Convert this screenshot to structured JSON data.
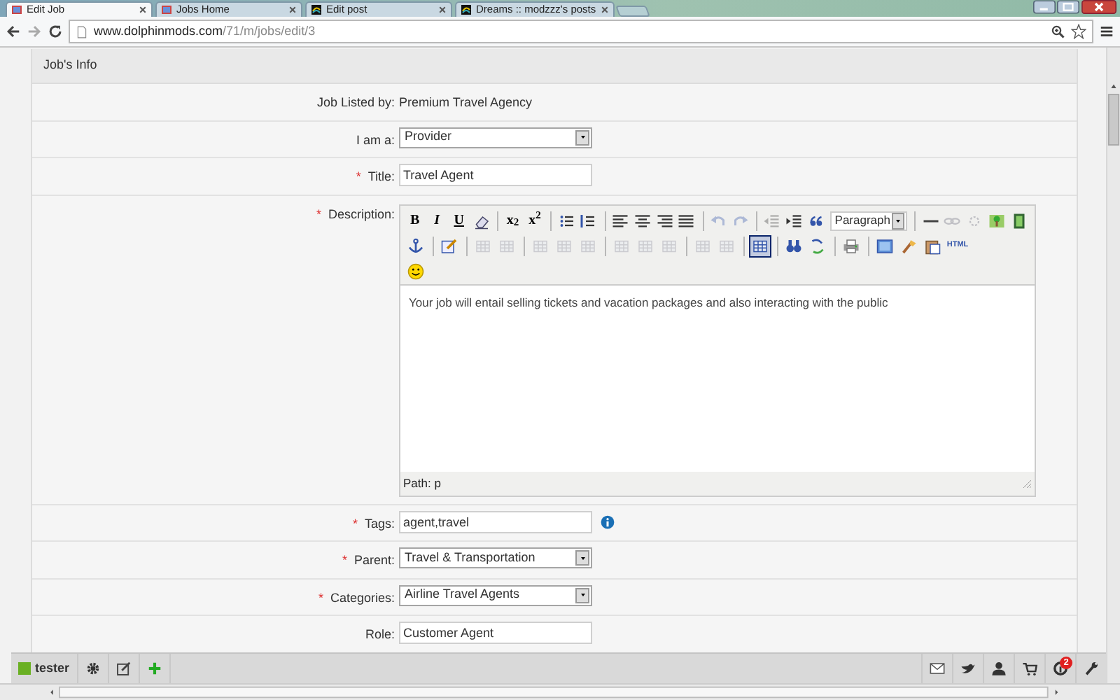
{
  "browser": {
    "tabs": [
      {
        "title": "Edit Job",
        "selected": true
      },
      {
        "title": "Jobs Home",
        "selected": false
      },
      {
        "title": "Edit post",
        "selected": false
      },
      {
        "title": "Dreams :: modzzz's posts",
        "selected": false
      }
    ],
    "address": {
      "host": "www.dolphinmods.com",
      "path": "/71/m/jobs/edit/3"
    }
  },
  "panel": {
    "title": "Job's Info"
  },
  "fields": [
    {
      "kind": "static",
      "label": "Job Listed by:",
      "info": false,
      "value": "Premium Travel Agency"
    },
    {
      "kind": "select",
      "label": "I am a:",
      "info": false,
      "value": "Provider"
    },
    {
      "kind": "text",
      "marker": "*",
      "label": "Title:",
      "info": false,
      "value": "Travel Agent"
    },
    {
      "kind": "editor",
      "marker": "*",
      "label": "Description:",
      "info": false
    },
    {
      "kind": "text",
      "marker": "*",
      "label": "Tags:",
      "info": true,
      "value": "agent,travel"
    },
    {
      "kind": "select",
      "marker": "*",
      "label": "Parent:",
      "info": false,
      "value": "Travel & Transportation"
    },
    {
      "kind": "select",
      "marker": "*",
      "label": "Categories:",
      "info": false,
      "value": "Airline Travel Agents"
    },
    {
      "kind": "text",
      "label": "Role:",
      "info": false,
      "value": "Customer Agent"
    }
  ],
  "editor": {
    "toolbar_rows": [
      [
        {
          "kind": "button",
          "label": "B",
          "disabled": false,
          "active": false
        },
        {
          "kind": "button",
          "label": "I",
          "disabled": false,
          "active": false
        },
        {
          "kind": "button",
          "label": "U",
          "disabled": false,
          "active": false
        },
        {
          "kind": "button",
          "disabled": false,
          "active": false
        },
        {
          "kind": "separator"
        },
        {
          "kind": "button",
          "label": "x$_{2}$",
          "disabled": false,
          "active": false
        },
        {
          "kind": "button",
          "label": "x$^{2}$",
          "disabled": false,
          "active": false
        },
        {
          "kind": "separator"
        },
        {
          "kind": "button",
          "disabled": false,
          "active": false
        },
        {
          "kind": "button",
          "disabled": false,
          "active": false
        },
        {
          "kind": "separator"
        },
        {
          "kind": "button",
          "disabled": false,
          "active": false
        },
        {
          "kind": "button",
          "disabled": false,
          "active": false
        },
        {
          "kind": "button",
          "disabled": false,
          "active": false
        },
        {
          "kind": "button",
          "disabled": false,
          "active": false
        },
        {
          "kind": "separator"
        },
        {
          "kind": "button",
          "disabled": true,
          "active": false
        },
        {
          "kind": "button",
          "disabled": true,
          "active": false
        },
        {
          "kind": "separator"
        },
        {
          "kind": "button",
          "disabled": true,
          "active": false
        },
        {
          "kind": "button",
          "disabled": false,
          "active": false
        },
        {
          "kind": "button",
          "disabled": false,
          "active": false
        },
        {
          "kind": "dropdown",
          "label": "Paragraph"
        },
        {
          "kind": "separator"
        },
        {
          "kind": "button",
          "disabled": false,
          "active": false
        },
        {
          "kind": "button",
          "disabled": true,
          "active": false
        },
        {
          "kind": "button",
          "disabled": true,
          "active": false
        },
        {
          "kind": "button",
          "disabled": false,
          "active": false
        },
        {
          "kind": "button",
          "disabled": false,
          "active": false
        }
      ],
      [
        {
          "kind": "button",
          "disabled": false,
          "active": false
        },
        {
          "kind": "separator"
        },
        {
          "kind": "button",
          "disabled": false,
          "active": false
        },
        {
          "kind": "separator"
        },
        {
          "kind": "button",
          "disabled": true,
          "active": false
        },
        {
          "kind": "button",
          "disabled": true,
          "active": false
        },
        {
          "kind": "separator"
        },
        {
          "kind": "button",
          "disabled": true,
          "active": false
        },
        {
          "kind": "button",
          "disabled": true,
          "active": false
        },
        {
          "kind": "button",
          "disabled": true,
          "active": false
        },
        {
          "kind": "separator"
        },
        {
          "kind": "button",
          "disabled": true,
          "active": false
        },
        {
          "kind": "button",
          "disabled": true,
          "active": false
        },
        {
          "kind": "button",
          "disabled": true,
          "active": false
        },
        {
          "kind": "separator"
        },
        {
          "kind": "button",
          "disabled": true,
          "active": false
        },
        {
          "kind": "button",
          "disabled": true,
          "active": false
        },
        {
          "kind": "separator"
        },
        {
          "kind": "button",
          "disabled": false,
          "active": true
        },
        {
          "kind": "separator"
        },
        {
          "kind": "button",
          "disabled": false,
          "active": false
        },
        {
          "kind": "button",
          "disabled": false,
          "active": false
        },
        {
          "kind": "separator"
        },
        {
          "kind": "button",
          "disabled": false,
          "active": false
        },
        {
          "kind": "separator"
        },
        {
          "kind": "button",
          "disabled": false,
          "active": false
        },
        {
          "kind": "button",
          "disabled": false,
          "active": false
        },
        {
          "kind": "button",
          "disabled": false,
          "active": false
        },
        {
          "kind": "button",
          "label": "HTML",
          "disabled": false,
          "active": false
        }
      ],
      [
        {
          "kind": "button",
          "disabled": false,
          "active": false
        }
      ]
    ],
    "content": "Your job will entail selling tickets and vacation packages and also interacting with the public",
    "path": "Path: p"
  },
  "user_bar": {
    "username": "tester",
    "notification_count": "2"
  }
}
